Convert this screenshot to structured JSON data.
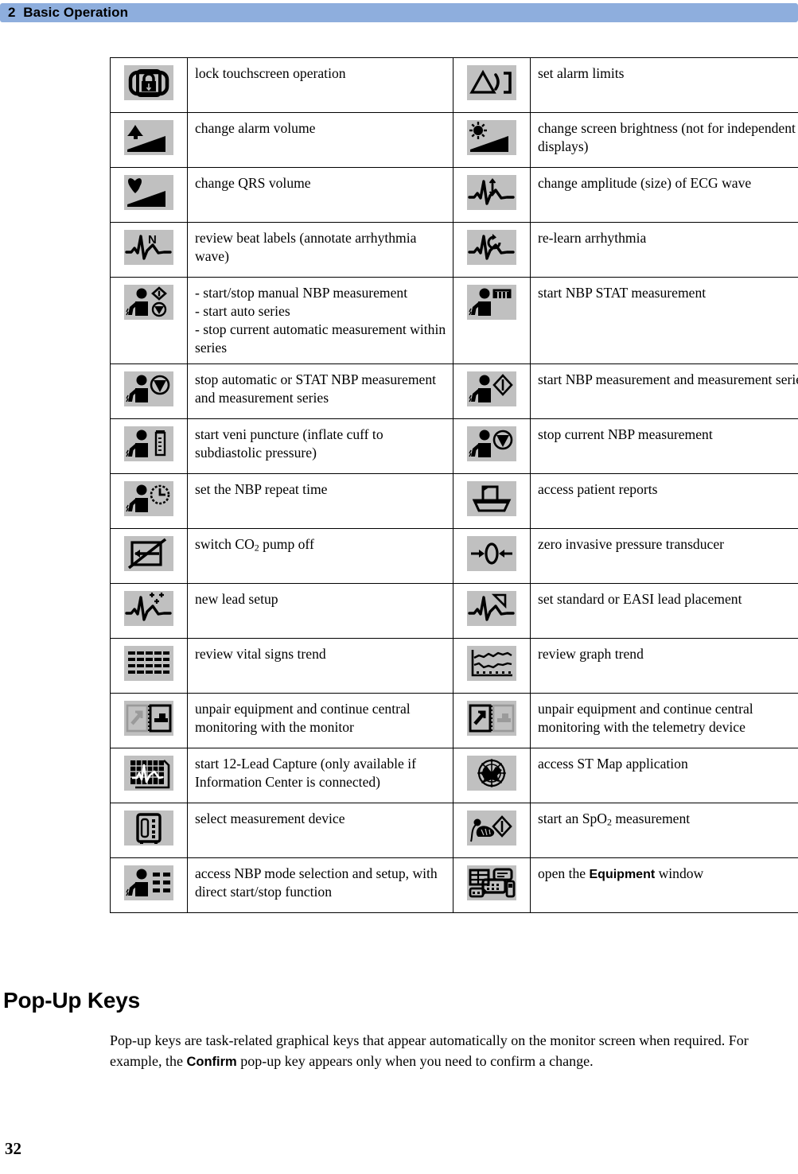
{
  "header": {
    "chapter_number": "2",
    "chapter_title": "Basic Operation",
    "full": "2  Basic Operation",
    "bar_color": "#8eaedd"
  },
  "folio": {
    "page_number": "32"
  },
  "section": {
    "heading": "Pop-Up Keys",
    "paragraph_part1": "Pop-up keys are task-related graphical keys that appear automatically on the monitor screen when required. For example, the ",
    "paragraph_bold": "Confirm",
    "paragraph_part2": " pop-up key appears only when you need to confirm a change."
  },
  "table": {
    "icon_background": "#c0c0c0",
    "rows": [
      {
        "left": {
          "icon": "lock-touchscreen-icon",
          "text": "lock touchscreen operation"
        },
        "right": {
          "icon": "alarm-limits-icon",
          "text": "set alarm limits"
        }
      },
      {
        "left": {
          "icon": "alarm-volume-icon",
          "text": "change alarm volume"
        },
        "right": {
          "icon": "screen-brightness-icon",
          "text": "change screen brightness (not for independent displays)"
        }
      },
      {
        "left": {
          "icon": "qrs-volume-icon",
          "text": "change QRS volume"
        },
        "right": {
          "icon": "ecg-amplitude-icon",
          "text": "change amplitude (size) of ECG wave"
        }
      },
      {
        "left": {
          "icon": "review-beat-labels-icon",
          "text": "review beat labels (annotate arrhythmia wave)"
        },
        "right": {
          "icon": "relearn-arrhythmia-icon",
          "text": "re-learn arrhythmia"
        }
      },
      {
        "left": {
          "icon": "nbp-manual-start-stop-icon",
          "text": "- start/stop manual NBP measurement\n- start auto series\n- stop current automatic measurement within series"
        },
        "right": {
          "icon": "nbp-stat-icon",
          "text": "start NBP STAT measurement"
        }
      },
      {
        "left": {
          "icon": "nbp-stop-auto-stat-icon",
          "text": "stop automatic or STAT NBP measurement and measurement series"
        },
        "right": {
          "icon": "nbp-start-series-icon",
          "text": "start NBP measurement and measurement series"
        }
      },
      {
        "left": {
          "icon": "veni-puncture-icon",
          "text": "start veni puncture (inflate cuff to subdiastolic pressure)"
        },
        "right": {
          "icon": "nbp-stop-current-icon",
          "text": "stop current NBP measurement"
        }
      },
      {
        "left": {
          "icon": "nbp-repeat-time-icon",
          "text": "set the NBP repeat time"
        },
        "right": {
          "icon": "patient-reports-icon",
          "text": "access patient reports"
        }
      },
      {
        "left": {
          "icon": "co2-pump-off-icon",
          "text_prefix": "switch CO",
          "text_sub": "2",
          "text_suffix": " pump off"
        },
        "right": {
          "icon": "zero-pressure-transducer-icon",
          "text": "zero invasive pressure transducer"
        }
      },
      {
        "left": {
          "icon": "new-lead-setup-icon",
          "text": "new lead setup"
        },
        "right": {
          "icon": "easi-lead-placement-icon",
          "text": "set standard or EASI lead placement"
        }
      },
      {
        "left": {
          "icon": "vital-signs-trend-icon",
          "text": "review vital signs trend"
        },
        "right": {
          "icon": "graph-trend-icon",
          "text": "review graph trend"
        }
      },
      {
        "left": {
          "icon": "unpair-monitor-icon",
          "text": "unpair equipment and continue central monitoring with the monitor"
        },
        "right": {
          "icon": "unpair-telemetry-icon",
          "text": "unpair equipment and continue central monitoring with the telemetry device"
        }
      },
      {
        "left": {
          "icon": "twelve-lead-capture-icon",
          "text": "start 12-Lead Capture (only available if Information Center is connected)"
        },
        "right": {
          "icon": "st-map-icon",
          "text": "access ST Map application"
        }
      },
      {
        "left": {
          "icon": "select-measurement-device-icon",
          "text": "select measurement device"
        },
        "right": {
          "icon": "spo2-measurement-icon",
          "text_prefix": "start an SpO",
          "text_sub": "2",
          "text_suffix": " measurement"
        }
      },
      {
        "left": {
          "icon": "nbp-mode-setup-icon",
          "text": "access NBP mode selection and setup, with direct start/stop function"
        },
        "right": {
          "icon": "equipment-window-icon",
          "text_prefix": "open the ",
          "text_bold": "Equipment",
          "text_suffix": " window"
        }
      }
    ]
  }
}
